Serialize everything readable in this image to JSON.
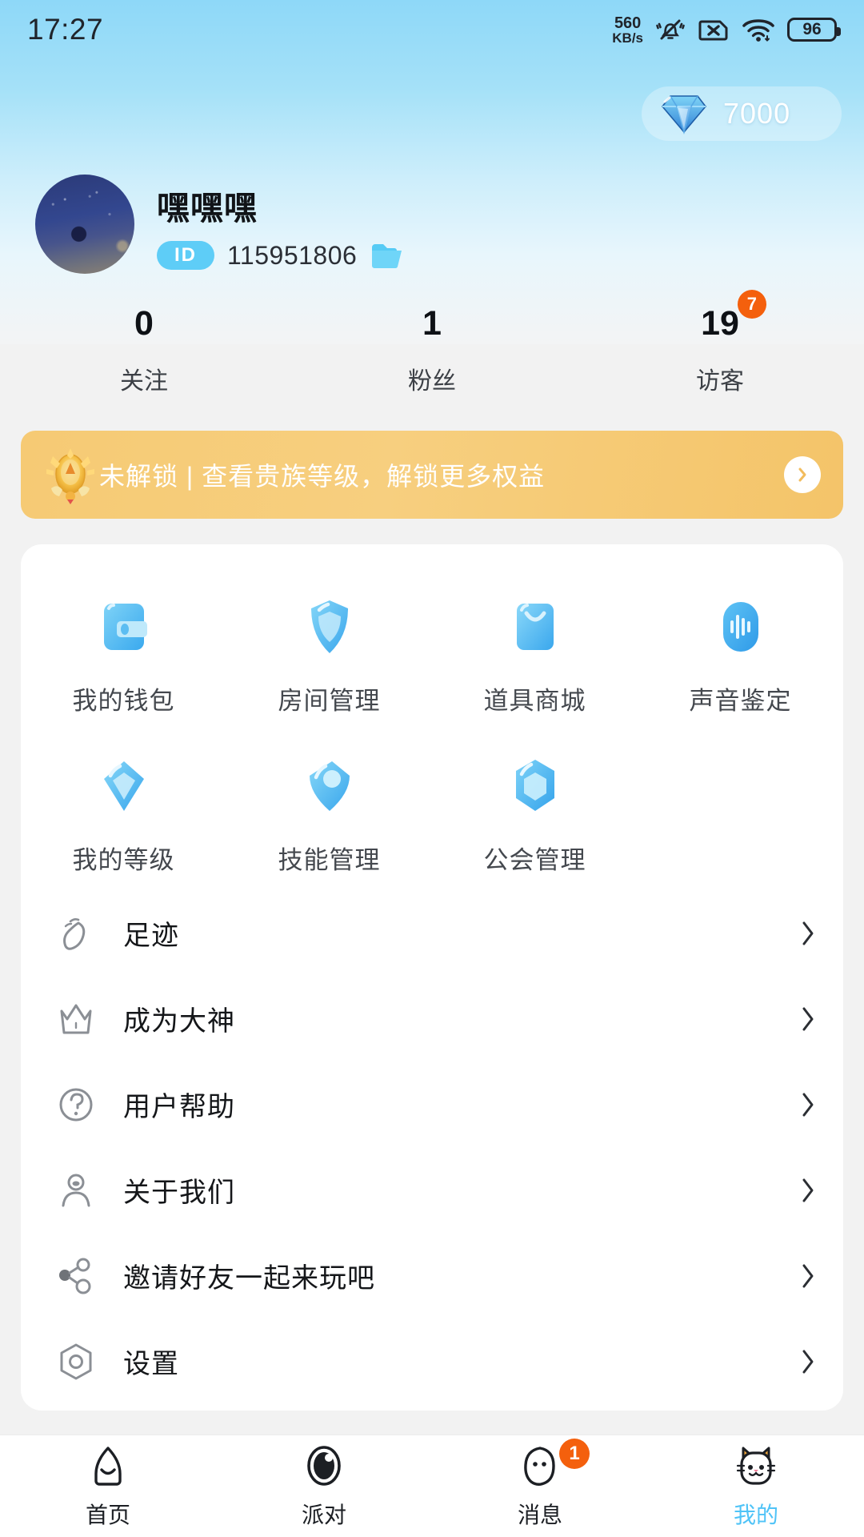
{
  "status_bar": {
    "time": "17:27",
    "net_speed_value": "560",
    "net_speed_unit": "KB/s",
    "icons": [
      "mute-vibrate-icon",
      "no-sim-icon",
      "wifi-icon"
    ],
    "battery_percent": "96"
  },
  "currency": {
    "icon": "diamond-icon",
    "amount": "7000"
  },
  "profile": {
    "avatar": "user-avatar",
    "nickname": "嘿嘿嘿",
    "id_label": "ID",
    "id_value": "115951806",
    "copy_icon": "folder-icon"
  },
  "stats": [
    {
      "value": "0",
      "label": "关注",
      "badge": ""
    },
    {
      "value": "1",
      "label": "粉丝",
      "badge": ""
    },
    {
      "value": "19",
      "label": "访客",
      "badge": "7"
    }
  ],
  "noble_banner": {
    "icon": "crown-badge-icon",
    "text": "未解锁 | 查看贵族等级，解锁更多权益",
    "arrow_icon": "chevron-right-icon"
  },
  "grid": [
    {
      "label": "我的钱包",
      "icon": "wallet-icon"
    },
    {
      "label": "房间管理",
      "icon": "shield-icon"
    },
    {
      "label": "道具商城",
      "icon": "shopping-bag-icon"
    },
    {
      "label": "声音鉴定",
      "icon": "sound-wave-icon"
    },
    {
      "label": "我的等级",
      "icon": "diamond-level-icon"
    },
    {
      "label": "技能管理",
      "icon": "tag-icon"
    },
    {
      "label": "公会管理",
      "icon": "hexagon-icon"
    }
  ],
  "menu": [
    {
      "label": "足迹",
      "icon": "footprint-icon"
    },
    {
      "label": "成为大神",
      "icon": "crown-icon"
    },
    {
      "label": "用户帮助",
      "icon": "question-circle-icon"
    },
    {
      "label": "关于我们",
      "icon": "person-icon"
    },
    {
      "label": "邀请好友一起来玩吧",
      "icon": "share-icon"
    },
    {
      "label": "设置",
      "icon": "settings-icon"
    }
  ],
  "tabs": [
    {
      "label": "首页",
      "icon": "home-icon",
      "badge": "",
      "active": false
    },
    {
      "label": "派对",
      "icon": "party-icon",
      "badge": "",
      "active": false
    },
    {
      "label": "消息",
      "icon": "message-icon",
      "badge": "1",
      "active": false
    },
    {
      "label": "我的",
      "icon": "cat-icon",
      "badge": "",
      "active": true
    }
  ],
  "colors": {
    "accent": "#4fc3f7",
    "badge": "#f4600d",
    "noble": "#f6ca74",
    "hero_top": "#8ed8f8",
    "page_bg": "#f2f2f2"
  }
}
